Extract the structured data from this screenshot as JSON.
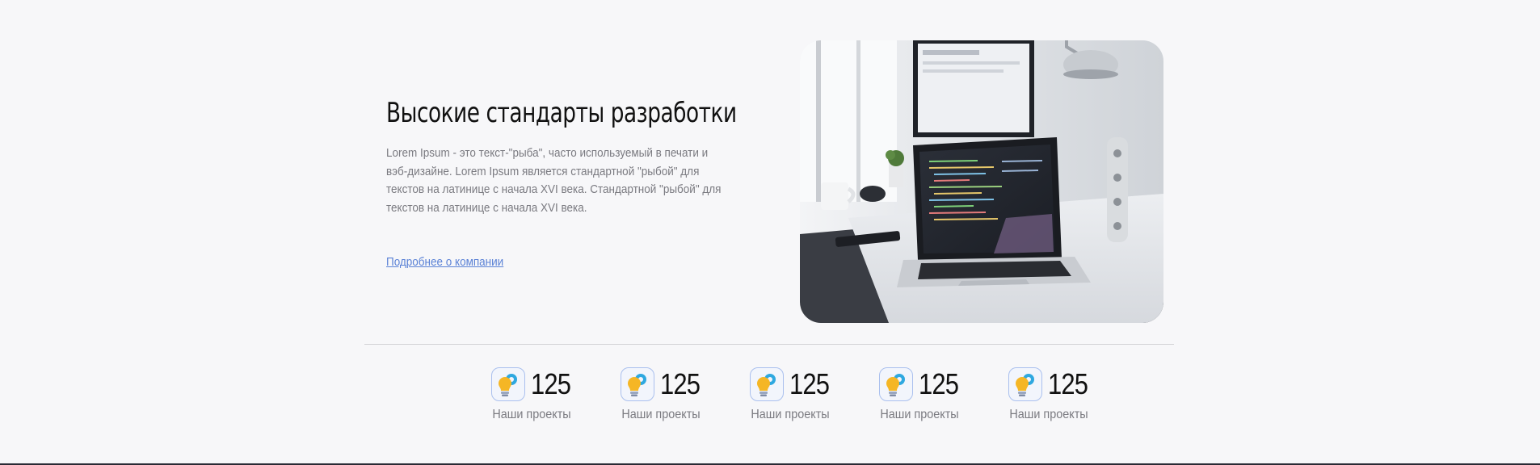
{
  "about": {
    "title": "Высокие стандарты разработки",
    "description": "Lorem Ipsum - это текст-\"рыба\", часто используемый в печати и вэб-дизайне. Lorem Ipsum является стандартной \"рыбой\" для текстов на латинице с начала XVI века. Стандартной \"рыбой\" для текстов на латинице с начала XVI века.",
    "link_label": "Подробнее о компании",
    "image_icon": "workspace-laptop-photo"
  },
  "stats": [
    {
      "icon": "lightbulb-gear-icon",
      "value": "125",
      "label": "Наши проекты"
    },
    {
      "icon": "lightbulb-gear-icon",
      "value": "125",
      "label": "Наши проекты"
    },
    {
      "icon": "lightbulb-gear-icon",
      "value": "125",
      "label": "Наши проекты"
    },
    {
      "icon": "lightbulb-gear-icon",
      "value": "125",
      "label": "Наши проекты"
    },
    {
      "icon": "lightbulb-gear-icon",
      "value": "125",
      "label": "Наши проекты"
    }
  ],
  "colors": {
    "background": "#f7f7f9",
    "heading": "#111111",
    "body_text": "#7a7a80",
    "link": "#5b82d6",
    "icon_border": "#aac0ee",
    "bulb": "#f5b625",
    "gear": "#2ea8e0"
  }
}
